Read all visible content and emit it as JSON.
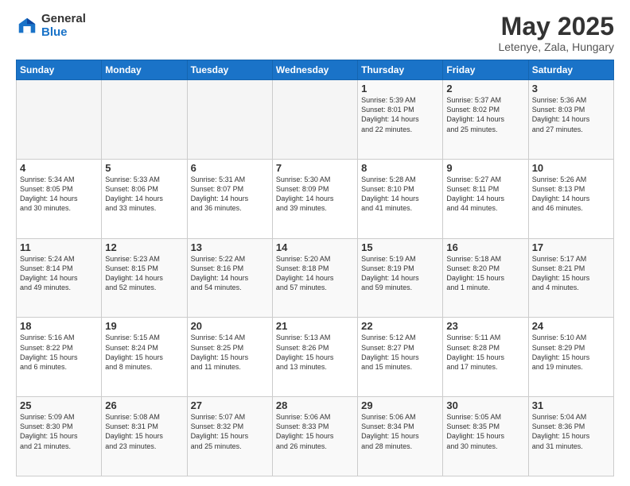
{
  "logo": {
    "general": "General",
    "blue": "Blue"
  },
  "title": "May 2025",
  "subtitle": "Letenye, Zala, Hungary",
  "weekdays": [
    "Sunday",
    "Monday",
    "Tuesday",
    "Wednesday",
    "Thursday",
    "Friday",
    "Saturday"
  ],
  "weeks": [
    [
      {
        "day": "",
        "info": ""
      },
      {
        "day": "",
        "info": ""
      },
      {
        "day": "",
        "info": ""
      },
      {
        "day": "",
        "info": ""
      },
      {
        "day": "1",
        "info": "Sunrise: 5:39 AM\nSunset: 8:01 PM\nDaylight: 14 hours\nand 22 minutes."
      },
      {
        "day": "2",
        "info": "Sunrise: 5:37 AM\nSunset: 8:02 PM\nDaylight: 14 hours\nand 25 minutes."
      },
      {
        "day": "3",
        "info": "Sunrise: 5:36 AM\nSunset: 8:03 PM\nDaylight: 14 hours\nand 27 minutes."
      }
    ],
    [
      {
        "day": "4",
        "info": "Sunrise: 5:34 AM\nSunset: 8:05 PM\nDaylight: 14 hours\nand 30 minutes."
      },
      {
        "day": "5",
        "info": "Sunrise: 5:33 AM\nSunset: 8:06 PM\nDaylight: 14 hours\nand 33 minutes."
      },
      {
        "day": "6",
        "info": "Sunrise: 5:31 AM\nSunset: 8:07 PM\nDaylight: 14 hours\nand 36 minutes."
      },
      {
        "day": "7",
        "info": "Sunrise: 5:30 AM\nSunset: 8:09 PM\nDaylight: 14 hours\nand 39 minutes."
      },
      {
        "day": "8",
        "info": "Sunrise: 5:28 AM\nSunset: 8:10 PM\nDaylight: 14 hours\nand 41 minutes."
      },
      {
        "day": "9",
        "info": "Sunrise: 5:27 AM\nSunset: 8:11 PM\nDaylight: 14 hours\nand 44 minutes."
      },
      {
        "day": "10",
        "info": "Sunrise: 5:26 AM\nSunset: 8:13 PM\nDaylight: 14 hours\nand 46 minutes."
      }
    ],
    [
      {
        "day": "11",
        "info": "Sunrise: 5:24 AM\nSunset: 8:14 PM\nDaylight: 14 hours\nand 49 minutes."
      },
      {
        "day": "12",
        "info": "Sunrise: 5:23 AM\nSunset: 8:15 PM\nDaylight: 14 hours\nand 52 minutes."
      },
      {
        "day": "13",
        "info": "Sunrise: 5:22 AM\nSunset: 8:16 PM\nDaylight: 14 hours\nand 54 minutes."
      },
      {
        "day": "14",
        "info": "Sunrise: 5:20 AM\nSunset: 8:18 PM\nDaylight: 14 hours\nand 57 minutes."
      },
      {
        "day": "15",
        "info": "Sunrise: 5:19 AM\nSunset: 8:19 PM\nDaylight: 14 hours\nand 59 minutes."
      },
      {
        "day": "16",
        "info": "Sunrise: 5:18 AM\nSunset: 8:20 PM\nDaylight: 15 hours\nand 1 minute."
      },
      {
        "day": "17",
        "info": "Sunrise: 5:17 AM\nSunset: 8:21 PM\nDaylight: 15 hours\nand 4 minutes."
      }
    ],
    [
      {
        "day": "18",
        "info": "Sunrise: 5:16 AM\nSunset: 8:22 PM\nDaylight: 15 hours\nand 6 minutes."
      },
      {
        "day": "19",
        "info": "Sunrise: 5:15 AM\nSunset: 8:24 PM\nDaylight: 15 hours\nand 8 minutes."
      },
      {
        "day": "20",
        "info": "Sunrise: 5:14 AM\nSunset: 8:25 PM\nDaylight: 15 hours\nand 11 minutes."
      },
      {
        "day": "21",
        "info": "Sunrise: 5:13 AM\nSunset: 8:26 PM\nDaylight: 15 hours\nand 13 minutes."
      },
      {
        "day": "22",
        "info": "Sunrise: 5:12 AM\nSunset: 8:27 PM\nDaylight: 15 hours\nand 15 minutes."
      },
      {
        "day": "23",
        "info": "Sunrise: 5:11 AM\nSunset: 8:28 PM\nDaylight: 15 hours\nand 17 minutes."
      },
      {
        "day": "24",
        "info": "Sunrise: 5:10 AM\nSunset: 8:29 PM\nDaylight: 15 hours\nand 19 minutes."
      }
    ],
    [
      {
        "day": "25",
        "info": "Sunrise: 5:09 AM\nSunset: 8:30 PM\nDaylight: 15 hours\nand 21 minutes."
      },
      {
        "day": "26",
        "info": "Sunrise: 5:08 AM\nSunset: 8:31 PM\nDaylight: 15 hours\nand 23 minutes."
      },
      {
        "day": "27",
        "info": "Sunrise: 5:07 AM\nSunset: 8:32 PM\nDaylight: 15 hours\nand 25 minutes."
      },
      {
        "day": "28",
        "info": "Sunrise: 5:06 AM\nSunset: 8:33 PM\nDaylight: 15 hours\nand 26 minutes."
      },
      {
        "day": "29",
        "info": "Sunrise: 5:06 AM\nSunset: 8:34 PM\nDaylight: 15 hours\nand 28 minutes."
      },
      {
        "day": "30",
        "info": "Sunrise: 5:05 AM\nSunset: 8:35 PM\nDaylight: 15 hours\nand 30 minutes."
      },
      {
        "day": "31",
        "info": "Sunrise: 5:04 AM\nSunset: 8:36 PM\nDaylight: 15 hours\nand 31 minutes."
      }
    ]
  ]
}
